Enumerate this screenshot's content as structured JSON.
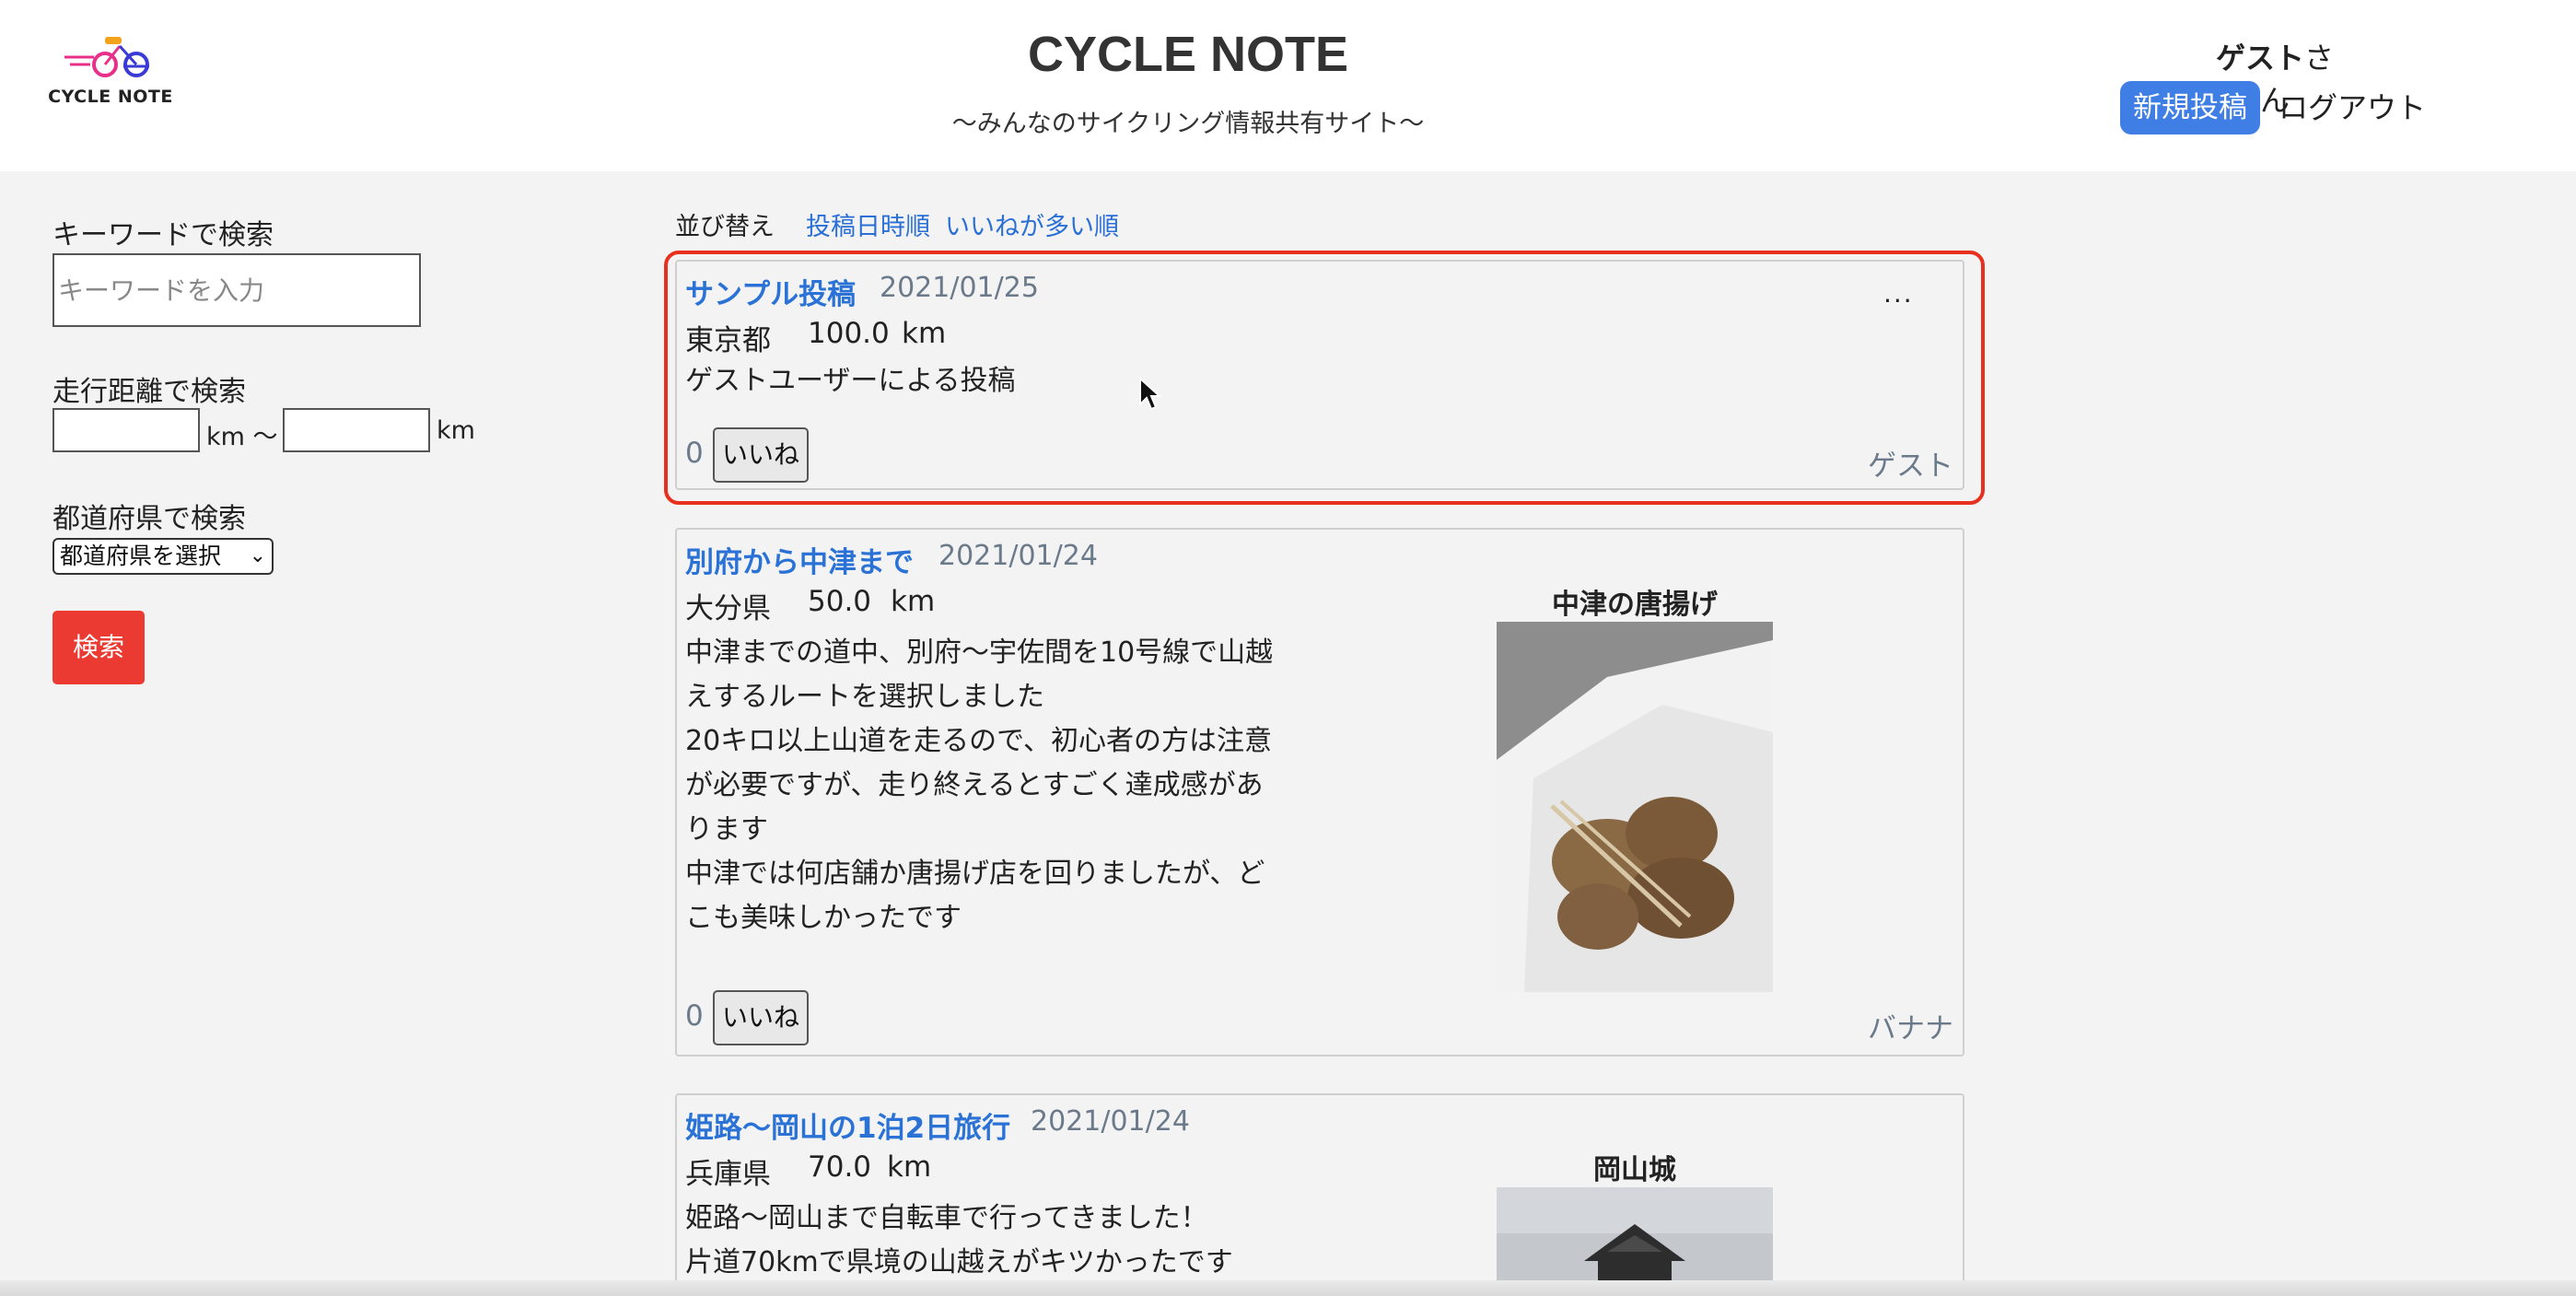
{
  "header": {
    "logo_text": "CYCLE NOTE",
    "site_title": "CYCLE NOTE",
    "site_subtitle": "〜みんなのサイクリング情報共有サイト〜",
    "user_name": "ゲスト",
    "user_suffix": "さん",
    "new_post_label": "新規投稿",
    "logout_label": "ログアウト"
  },
  "sidebar": {
    "keyword_label": "キーワードで検索",
    "keyword_placeholder": "キーワードを入力",
    "distance_label": "走行距離で検索",
    "km_unit": "km",
    "km_range_sep": "km 〜",
    "prefecture_label": "都道府県で検索",
    "prefecture_select_value": "都道府県を選択",
    "search_button": "検索"
  },
  "sort": {
    "label": "並び替え",
    "options": [
      "投稿日時順",
      "いいねが多い順"
    ]
  },
  "posts": [
    {
      "title": "サンプル投稿",
      "date": "2021/01/25",
      "prefecture": "東京都",
      "distance": "100.0",
      "unit": "km",
      "body": "ゲストユーザーによる投稿",
      "likes": "0",
      "like_label": "いいね",
      "author": "ゲスト",
      "more": "..."
    },
    {
      "title": "別府から中津まで",
      "date": "2021/01/24",
      "prefecture": "大分県",
      "distance": "50.0",
      "unit": "km",
      "body_lines": [
        "中津までの道中、別府〜宇佐間を10号線で山越",
        "えするルートを選択しました",
        "20キロ以上山道を走るので、初心者の方は注意",
        "が必要ですが、走り終えるとすごく達成感があ",
        "ります",
        "中津では何店舗か唐揚げ店を回りましたが、ど",
        "こも美味しかったです"
      ],
      "image_caption": "中津の唐揚げ",
      "likes": "0",
      "like_label": "いいね",
      "author": "バナナ"
    },
    {
      "title": "姫路〜岡山の1泊2日旅行",
      "date": "2021/01/24",
      "prefecture": "兵庫県",
      "distance": "70.0",
      "unit": "km",
      "body_lines": [
        "姫路〜岡山まで自転車で行ってきました！",
        "片道70kmで県境の山越えがキツかったです"
      ],
      "image_caption": "岡山城"
    }
  ],
  "colors": {
    "accent_blue": "#3f7fe5",
    "link_blue": "#2a72d6",
    "search_red": "#ea3a32",
    "highlight_red": "#e8301e"
  }
}
